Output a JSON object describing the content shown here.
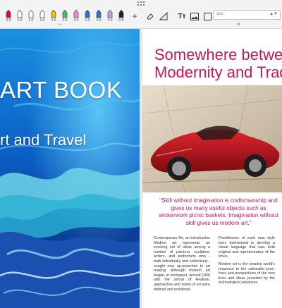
{
  "toolbar": {
    "pens": [
      {
        "color": "#e2004a",
        "size": "0.5"
      },
      {
        "color": "#ffffff",
        "size": "1.0"
      },
      {
        "color": "#ffffff",
        "size": "1.0"
      },
      {
        "color": "#ffffff",
        "size": "1.0"
      },
      {
        "color": "#e8c200",
        "size": "2.0"
      },
      {
        "color": "#3cc06c",
        "size": "2.0"
      },
      {
        "color": "#e58fd0",
        "size": "4.0"
      },
      {
        "color": "#2a6fdb",
        "size": "1.0"
      },
      {
        "color": "#2a6fdb",
        "size": "2.0"
      },
      {
        "color": "#c99ce8",
        "size": "2.0"
      },
      {
        "color": "#222222",
        "size": "0.5"
      }
    ],
    "tiny_label": "0.5",
    "add_label": "+",
    "search_placeholder": "ace",
    "search_arrow": "▲▼",
    "close_label": "×"
  },
  "left_page": {
    "title": "ART BOOK",
    "subtitle": "rt and Travel"
  },
  "right_page": {
    "heading_line1": "Somewhere between",
    "heading_line2": "Modernity and Tradit",
    "quote": "“Skill without imagination is craftsmanship and gives us many useful objects such as wickerwork picnic baskets. Imagination without skill gives us modern art.”",
    "col_left_p1": "Contemporary Art, an introduction Modern art represents an evolving set of ideas among a number of painters, sculptors, writers, and performers who - both individually and collectively - sought new ap-proaches to art making. Although modern art began, in retrospect, around 1850 with the arrival of Realism, approaches and styles of art were defined and redefined.",
    "col_right_p1": "Practitioners of each new style were determined to develop a visual language that was both original and representative of the times.",
    "col_right_p2": "Modern art is the creative world's response to the rationalist prac-tices and perspectives of the new lives and ideas provided by the technological advances."
  }
}
